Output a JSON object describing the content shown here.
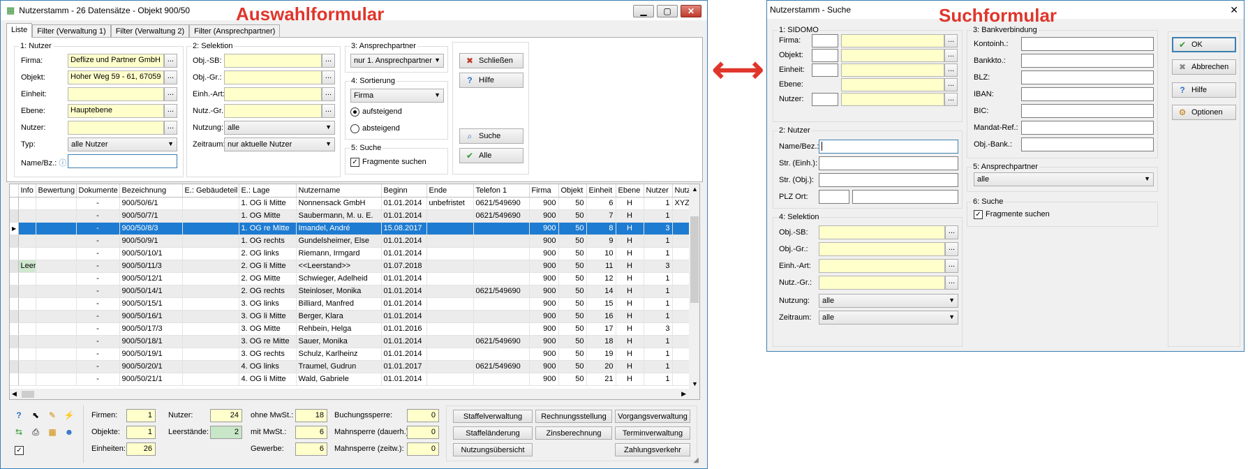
{
  "annotations": {
    "auswahl": "Auswahlformular",
    "such": "Suchformular",
    "arrow": "⟷"
  },
  "colors": {
    "accent": "#e0352b",
    "selection": "#1d7bd1",
    "highlight_input": "#ffffcc",
    "leerstand": "#cfe8cf"
  },
  "main": {
    "title": "Nutzerstamm - 26 Datensätze - Objekt 900/50",
    "icons": {
      "app": "app-icon",
      "minimize": "minimize-icon",
      "maximize": "maximize-icon",
      "close": "close-icon"
    },
    "tabs": [
      "Liste",
      "Filter (Verwaltung 1)",
      "Filter (Verwaltung 2)",
      "Filter (Ansprechpartner)"
    ],
    "nutzer": {
      "legend": "1: Nutzer",
      "firma_label": "Firma:",
      "firma_value": "Deflize und Partner GmbH",
      "objekt_label": "Objekt:",
      "objekt_value": "Hoher Weg 59 - 61, 67059",
      "einheit_label": "Einheit:",
      "einheit_value": "",
      "ebene_label": "Ebene:",
      "ebene_value": "Hauptebene",
      "nutzer_label": "Nutzer:",
      "nutzer_value": "",
      "typ_label": "Typ:",
      "typ_value": "alle Nutzer",
      "namebz_label": "Name/Bz.:",
      "namebz_value": ""
    },
    "selektion": {
      "legend": "2: Selektion",
      "objsb_label": "Obj.-SB:",
      "objgr_label": "Obj.-Gr.:",
      "eihart_label": "Einh.-Art:",
      "nutzgr_label": "Nutz.-Gr.:",
      "nutzung_label": "Nutzung:",
      "nutzung_value": "alle",
      "zeitraum_label": "Zeitraum:",
      "zeitraum_value": "nur aktuelle Nutzer"
    },
    "ansprechpartner": {
      "legend": "3: Ansprechpartner",
      "value": "nur 1. Ansprechpartner"
    },
    "sortierung": {
      "legend": "4: Sortierung",
      "value": "Firma",
      "asc": "aufsteigend",
      "desc": "absteigend"
    },
    "suche": {
      "legend": "5: Suche",
      "fragmente": "Fragmente suchen"
    },
    "buttons": {
      "schliessen": "Schließen",
      "hilfe": "Hilfe",
      "suche": "Suche",
      "alle": "Alle"
    },
    "columns": [
      "Info",
      "Bewertung",
      "Dokumente",
      "Bezeichnung",
      "E.: Gebäudeteil",
      "E.: Lage",
      "Nutzername",
      "Beginn",
      "Ende",
      "Telefon 1",
      "Firma",
      "Objekt",
      "Einheit",
      "Ebene",
      "Nutzer",
      "Nutz"
    ],
    "rows": [
      {
        "info": "",
        "dok": "-",
        "bez": "900/50/6/1",
        "lage": "1. OG li Mitte",
        "name": "Nonnensack GmbH",
        "beginn": "01.01.2014",
        "ende": "unbefristet",
        "tel": "0621/549690",
        "firma": "900",
        "objekt": "50",
        "einheit": "6",
        "ebene": "H",
        "nutzer": "1",
        "nutz": "XYZ-"
      },
      {
        "info": "",
        "dok": "-",
        "bez": "900/50/7/1",
        "lage": "1. OG Mitte",
        "name": "Saubermann, M. u. E.",
        "beginn": "01.01.2014",
        "ende": "",
        "tel": "0621/549690",
        "firma": "900",
        "objekt": "50",
        "einheit": "7",
        "ebene": "H",
        "nutzer": "1",
        "nutz": ""
      },
      {
        "info": "",
        "dok": "-",
        "bez": "900/50/8/3",
        "lage": "1. OG re Mitte",
        "name": "Imandel, André",
        "beginn": "15.08.2017",
        "ende": "",
        "tel": "",
        "firma": "900",
        "objekt": "50",
        "einheit": "8",
        "ebene": "H",
        "nutzer": "3",
        "nutz": ""
      },
      {
        "info": "",
        "dok": "-",
        "bez": "900/50/9/1",
        "lage": "1. OG rechts",
        "name": "Gundelsheimer, Else",
        "beginn": "01.01.2014",
        "ende": "",
        "tel": "",
        "firma": "900",
        "objekt": "50",
        "einheit": "9",
        "ebene": "H",
        "nutzer": "1",
        "nutz": ""
      },
      {
        "info": "",
        "dok": "-",
        "bez": "900/50/10/1",
        "lage": "2. OG links",
        "name": "Riemann, Irmgard",
        "beginn": "01.01.2014",
        "ende": "",
        "tel": "",
        "firma": "900",
        "objekt": "50",
        "einheit": "10",
        "ebene": "H",
        "nutzer": "1",
        "nutz": ""
      },
      {
        "info": "Leer",
        "dok": "-",
        "bez": "900/50/11/3",
        "lage": "2. OG li Mitte",
        "name": "<<Leerstand>>",
        "beginn": "01.07.2018",
        "ende": "",
        "tel": "",
        "firma": "900",
        "objekt": "50",
        "einheit": "11",
        "ebene": "H",
        "nutzer": "3",
        "nutz": ""
      },
      {
        "info": "",
        "dok": "-",
        "bez": "900/50/12/1",
        "lage": "2. OG Mitte",
        "name": "Schwieger, Adelheid",
        "beginn": "01.01.2014",
        "ende": "",
        "tel": "",
        "firma": "900",
        "objekt": "50",
        "einheit": "12",
        "ebene": "H",
        "nutzer": "1",
        "nutz": ""
      },
      {
        "info": "",
        "dok": "-",
        "bez": "900/50/14/1",
        "lage": "2. OG rechts",
        "name": "Steinloser, Monika",
        "beginn": "01.01.2014",
        "ende": "",
        "tel": "0621/549690",
        "firma": "900",
        "objekt": "50",
        "einheit": "14",
        "ebene": "H",
        "nutzer": "1",
        "nutz": ""
      },
      {
        "info": "",
        "dok": "-",
        "bez": "900/50/15/1",
        "lage": "3. OG links",
        "name": "Billiard, Manfred",
        "beginn": "01.01.2014",
        "ende": "",
        "tel": "",
        "firma": "900",
        "objekt": "50",
        "einheit": "15",
        "ebene": "H",
        "nutzer": "1",
        "nutz": ""
      },
      {
        "info": "",
        "dok": "-",
        "bez": "900/50/16/1",
        "lage": "3. OG li Mitte",
        "name": "Berger, Klara",
        "beginn": "01.01.2014",
        "ende": "",
        "tel": "",
        "firma": "900",
        "objekt": "50",
        "einheit": "16",
        "ebene": "H",
        "nutzer": "1",
        "nutz": ""
      },
      {
        "info": "",
        "dok": "-",
        "bez": "900/50/17/3",
        "lage": "3. OG Mitte",
        "name": "Rehbein, Helga",
        "beginn": "01.01.2016",
        "ende": "",
        "tel": "",
        "firma": "900",
        "objekt": "50",
        "einheit": "17",
        "ebene": "H",
        "nutzer": "3",
        "nutz": ""
      },
      {
        "info": "",
        "dok": "-",
        "bez": "900/50/18/1",
        "lage": "3. OG re Mitte",
        "name": "Sauer, Monika",
        "beginn": "01.01.2014",
        "ende": "",
        "tel": "0621/549690",
        "firma": "900",
        "objekt": "50",
        "einheit": "18",
        "ebene": "H",
        "nutzer": "1",
        "nutz": ""
      },
      {
        "info": "",
        "dok": "-",
        "bez": "900/50/19/1",
        "lage": "3. OG rechts",
        "name": "Schulz, Karlheinz",
        "beginn": "01.01.2014",
        "ende": "",
        "tel": "",
        "firma": "900",
        "objekt": "50",
        "einheit": "19",
        "ebene": "H",
        "nutzer": "1",
        "nutz": ""
      },
      {
        "info": "",
        "dok": "-",
        "bez": "900/50/20/1",
        "lage": "4. OG links",
        "name": "Traumel, Gudrun",
        "beginn": "01.01.2017",
        "ende": "",
        "tel": "0621/549690",
        "firma": "900",
        "objekt": "50",
        "einheit": "20",
        "ebene": "H",
        "nutzer": "1",
        "nutz": ""
      },
      {
        "info": "",
        "dok": "-",
        "bez": "900/50/21/1",
        "lage": "4. OG li Mitte",
        "name": "Wald, Gabriele",
        "beginn": "01.01.2014",
        "ende": "",
        "tel": "",
        "firma": "900",
        "objekt": "50",
        "einheit": "21",
        "ebene": "H",
        "nutzer": "1",
        "nutz": ""
      }
    ],
    "selected_row": 2,
    "stats": {
      "firmen_label": "Firmen:",
      "firmen": "1",
      "objekte_label": "Objekte:",
      "objekte": "1",
      "einheiten_label": "Einheiten:",
      "einheiten": "26",
      "nutzer_label": "Nutzer:",
      "nutzer": "24",
      "leer_label": "Leerstände:",
      "leer": "2",
      "ohne_label": "ohne MwSt.:",
      "ohne": "18",
      "mit_label": "mit MwSt.:",
      "mit": "6",
      "gewerbe_label": "Gewerbe:",
      "gewerbe": "6",
      "buch_label": "Buchungssperre:",
      "buch": "0",
      "mahnd_label": "Mahnsperre (dauerh.):",
      "mahnd": "0",
      "mahnz_label": "Mahnsperre (zeitw.):",
      "mahnz": "0"
    },
    "actions": [
      "Staffelverwaltung",
      "Rechnungsstellung",
      "Vorgangsverwaltung",
      "Staffeländerung",
      "Zinsberechnung",
      "Terminverwaltung",
      "Nutzungsübersicht",
      "Zahlungsverkehr"
    ]
  },
  "search": {
    "title": "Nutzerstamm - Suche",
    "sidomo": {
      "legend": "1: SIDOMO",
      "labels": [
        "Firma:",
        "Objekt:",
        "Einheit:",
        "Ebene:",
        "Nutzer:"
      ]
    },
    "nutzer": {
      "legend": "2: Nutzer",
      "labels": [
        "Name/Bez.:",
        "Str. (Einh.):",
        "Str. (Obj.):",
        "PLZ Ort:"
      ]
    },
    "selektion": {
      "legend": "4: Selektion",
      "labels": [
        "Obj.-SB:",
        "Obj.-Gr.:",
        "Einh.-Art:",
        "Nutz.-Gr.:"
      ],
      "nutzung_label": "Nutzung:",
      "nutzung": "alle",
      "zeitraum_label": "Zeitraum:",
      "zeitraum": "alle"
    },
    "bank": {
      "legend": "3: Bankverbindung",
      "labels": [
        "Kontoinh.:",
        "Bankkto.:",
        "BLZ:",
        "IBAN:",
        "BIC:",
        "Mandat-Ref.:",
        "Obj.-Bank.:"
      ]
    },
    "ansprech": {
      "legend": "5: Ansprechpartner",
      "value": "alle"
    },
    "suche": {
      "legend": "6: Suche",
      "fragmente": "Fragmente suchen"
    },
    "buttons": {
      "ok": "OK",
      "abbrechen": "Abbrechen",
      "hilfe": "Hilfe",
      "optionen": "Optionen"
    }
  }
}
